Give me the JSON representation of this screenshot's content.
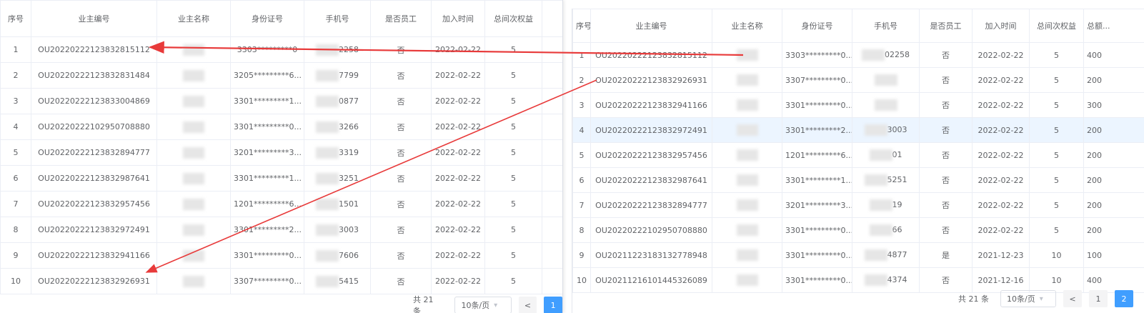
{
  "columns": {
    "seq": "序号",
    "owner_id": "业主编号",
    "owner_name": "业主名称",
    "id_card": "身份证号",
    "phone": "手机号",
    "is_employee": "是否员工",
    "join_time": "加入时间",
    "total_rights": "总间次权益",
    "total_amount": "总额..."
  },
  "left_table": {
    "rows": [
      {
        "seq": "1",
        "owner_id": "OU20220222123832815112",
        "id_card": "3303*********0",
        "phone_tail": "2258",
        "is_employee": "否",
        "join_time": "2022-02-22",
        "total_rights": "5"
      },
      {
        "seq": "2",
        "owner_id": "OU20220222123832831484",
        "id_card": "3205*********6...",
        "phone_tail": "7799",
        "is_employee": "否",
        "join_time": "2022-02-22",
        "total_rights": "5"
      },
      {
        "seq": "3",
        "owner_id": "OU20220222123833004869",
        "id_card": "3301*********1...",
        "phone_tail": "0877",
        "is_employee": "否",
        "join_time": "2022-02-22",
        "total_rights": "5"
      },
      {
        "seq": "4",
        "owner_id": "OU20220222102950708880",
        "id_card": "3301*********0...",
        "phone_tail": "3266",
        "is_employee": "否",
        "join_time": "2022-02-22",
        "total_rights": "5"
      },
      {
        "seq": "5",
        "owner_id": "OU20220222123832894777",
        "id_card": "3201*********3...",
        "phone_tail": "3319",
        "is_employee": "否",
        "join_time": "2022-02-22",
        "total_rights": "5"
      },
      {
        "seq": "6",
        "owner_id": "OU20220222123832987641",
        "id_card": "3301*********1...",
        "phone_tail": "3251",
        "is_employee": "否",
        "join_time": "2022-02-22",
        "total_rights": "5"
      },
      {
        "seq": "7",
        "owner_id": "OU20220222123832957456",
        "id_card": "1201*********6...",
        "phone_tail": "1501",
        "is_employee": "否",
        "join_time": "2022-02-22",
        "total_rights": "5"
      },
      {
        "seq": "8",
        "owner_id": "OU20220222123832972491",
        "id_card": "3301*********2...",
        "phone_tail": "3003",
        "is_employee": "否",
        "join_time": "2022-02-22",
        "total_rights": "5"
      },
      {
        "seq": "9",
        "owner_id": "OU20220222123832941166",
        "id_card": "3301*********0...",
        "phone_tail": "7606",
        "is_employee": "否",
        "join_time": "2022-02-22",
        "total_rights": "5"
      },
      {
        "seq": "10",
        "owner_id": "OU20220222123832926931",
        "id_card": "3307*********0...",
        "phone_tail": "5415",
        "is_employee": "否",
        "join_time": "2022-02-22",
        "total_rights": "5"
      }
    ],
    "pagination": {
      "total": "共 21 条",
      "page_size": "10条/页",
      "prev": "<",
      "pages": [
        "1"
      ]
    }
  },
  "right_table": {
    "rows": [
      {
        "seq": "1",
        "owner_id": "OU20220222123832815112",
        "id_card": "3303*********0...",
        "phone_tail": "02258",
        "is_employee": "否",
        "join_time": "2022-02-22",
        "total_rights": "5",
        "total_amount": "400"
      },
      {
        "seq": "2",
        "owner_id": "OU20220222123832926931",
        "id_card": "3307*********0...",
        "phone_tail": "",
        "is_employee": "否",
        "join_time": "2022-02-22",
        "total_rights": "5",
        "total_amount": "200"
      },
      {
        "seq": "3",
        "owner_id": "OU20220222123832941166",
        "id_card": "3301*********0...",
        "phone_tail": "",
        "is_employee": "否",
        "join_time": "2022-02-22",
        "total_rights": "5",
        "total_amount": "300"
      },
      {
        "seq": "4",
        "owner_id": "OU20220222123832972491",
        "id_card": "3301*********2...",
        "phone_tail": "3003",
        "is_employee": "否",
        "join_time": "2022-02-22",
        "total_rights": "5",
        "total_amount": "200"
      },
      {
        "seq": "5",
        "owner_id": "OU20220222123832957456",
        "id_card": "1201*********6...",
        "phone_tail": "01",
        "is_employee": "否",
        "join_time": "2022-02-22",
        "total_rights": "5",
        "total_amount": "200"
      },
      {
        "seq": "6",
        "owner_id": "OU20220222123832987641",
        "id_card": "3301*********1...",
        "phone_tail": "5251",
        "is_employee": "否",
        "join_time": "2022-02-22",
        "total_rights": "5",
        "total_amount": "200"
      },
      {
        "seq": "7",
        "owner_id": "OU20220222123832894777",
        "id_card": "3201*********3...",
        "phone_tail": "19",
        "is_employee": "否",
        "join_time": "2022-02-22",
        "total_rights": "5",
        "total_amount": "200"
      },
      {
        "seq": "8",
        "owner_id": "OU20220222102950708880",
        "id_card": "3301*********0...",
        "phone_tail": "66",
        "is_employee": "否",
        "join_time": "2022-02-22",
        "total_rights": "5",
        "total_amount": "200"
      },
      {
        "seq": "9",
        "owner_id": "OU20211223183132778948",
        "id_card": "3301*********0...",
        "phone_tail": "4877",
        "is_employee": "是",
        "join_time": "2021-12-23",
        "total_rights": "10",
        "total_amount": "100"
      },
      {
        "seq": "10",
        "owner_id": "OU20211216101445326089",
        "id_card": "3301*********0...",
        "phone_tail": "4374",
        "is_employee": "否",
        "join_time": "2021-12-16",
        "total_rights": "10",
        "total_amount": "400"
      }
    ],
    "highlight_row": 4,
    "pagination": {
      "total": "共 21 条",
      "page_size": "10条/页",
      "prev": "<",
      "pages": [
        "1",
        "2"
      ],
      "active": "2"
    }
  },
  "colors": {
    "accent": "#409eff",
    "arrow": "#e83a3a",
    "highlight": "#ecf5ff",
    "border": "#ebeef5"
  }
}
